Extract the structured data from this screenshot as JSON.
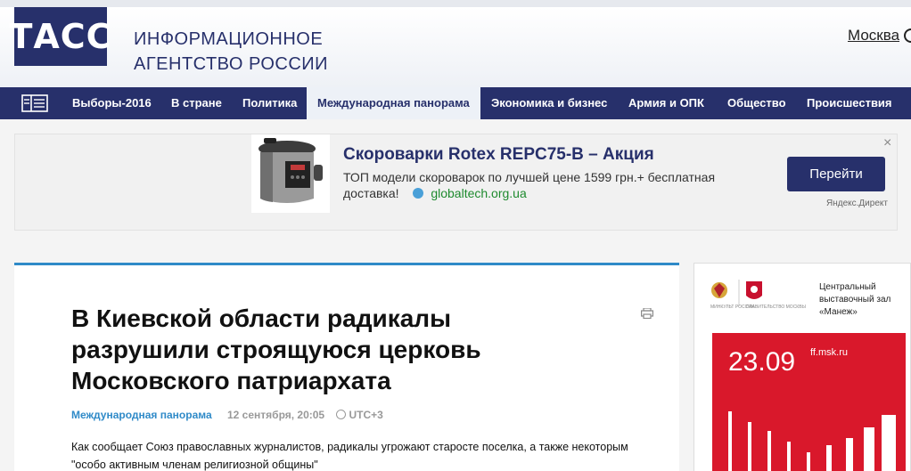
{
  "header": {
    "logo": "ТАСС",
    "agency_line1": "ИНФОРМАЦИОННОЕ",
    "agency_line2": "АГЕНТСТВО РОССИИ",
    "city": "Москва"
  },
  "nav": {
    "items": [
      {
        "label": "Выборы-2016"
      },
      {
        "label": "В стране"
      },
      {
        "label": "Политика"
      },
      {
        "label": "Международная панорама",
        "active": true
      },
      {
        "label": "Экономика и бизнес"
      },
      {
        "label": "Армия и ОПК"
      },
      {
        "label": "Общество"
      },
      {
        "label": "Происшествия"
      }
    ]
  },
  "ad": {
    "title": "Скороварки Rotex REPC75-B – Акция",
    "text": "ТОП модели скороварок по лучшей цене 1599 грн.+ бесплатная доставка!",
    "domain": "globaltech.org.ua",
    "button": "Перейти",
    "close": "×",
    "label": "Яндекс.Директ"
  },
  "article": {
    "title": "В Киевской области радикалы разрушили строящуюся церковь Московского патриархата",
    "category": "Международная панорама",
    "date": "12 сентября, 20:05",
    "timezone": "UTC+3",
    "lead": "Как сообщает Союз православных журналистов, радикалы угрожают старосте поселка, а также некоторым \"особо активным членам религиозной общины\""
  },
  "side": {
    "caption_left": "МИНКУЛЬТ РОССИИ",
    "caption_right": "ПРАВИТЕЛЬСТВО МОСКВЫ",
    "venue": "Центральный выставочный зал «Манеж»",
    "date": "23.09",
    "url": "ff.msk.ru"
  },
  "colors": {
    "brand": "#27306b",
    "accent": "#2f8ac8",
    "banner_red": "#d9182b"
  }
}
